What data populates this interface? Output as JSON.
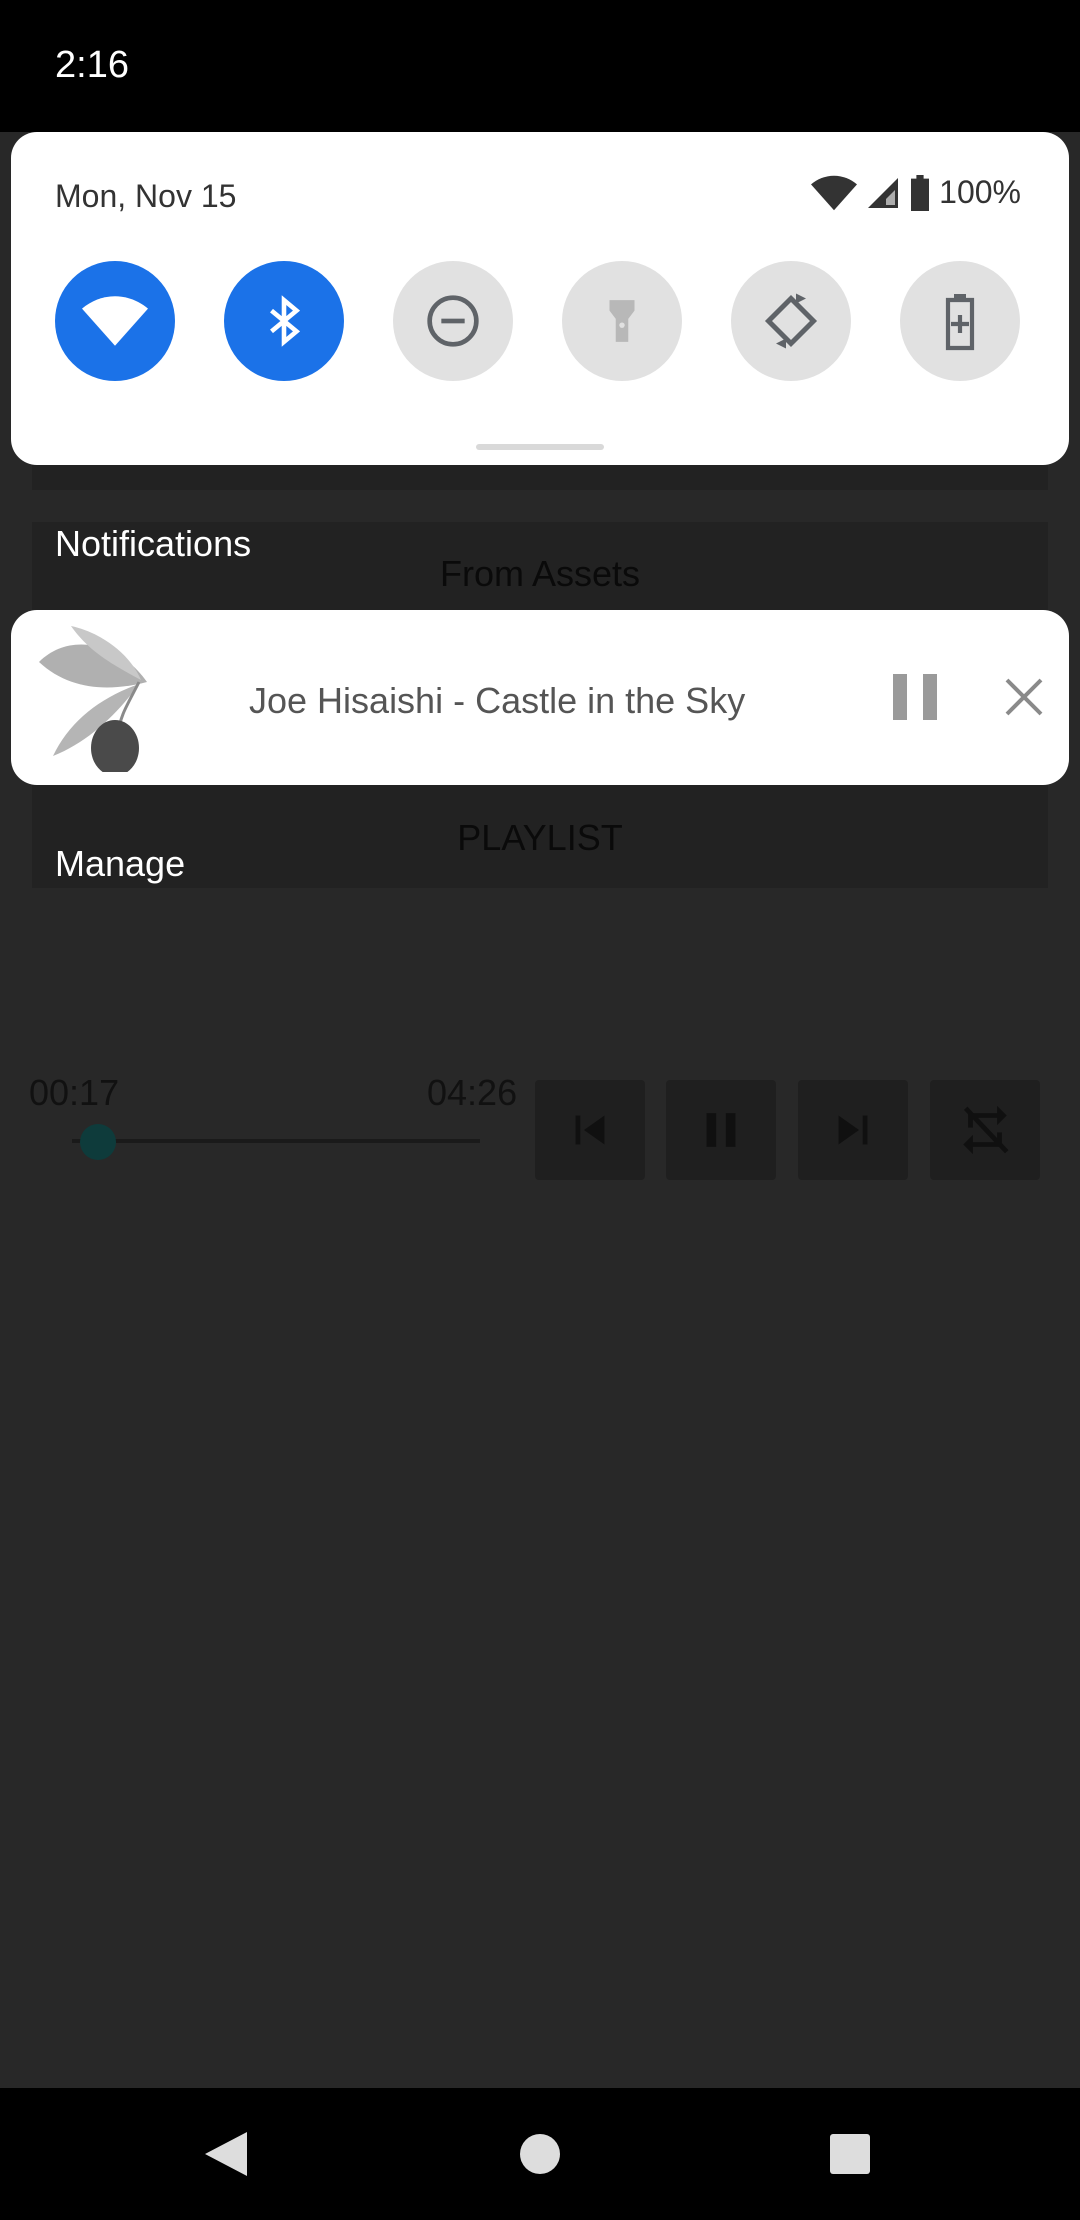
{
  "status_bar": {
    "time": "2:16"
  },
  "quick_settings": {
    "date": "Mon, Nov 15",
    "battery": "100%",
    "tiles": [
      {
        "name": "wifi",
        "icon": "wifi-icon",
        "state": "on"
      },
      {
        "name": "bluetooth",
        "icon": "bluetooth-icon",
        "state": "on"
      },
      {
        "name": "do-not-disturb",
        "icon": "do-not-disturb-icon",
        "state": "off"
      },
      {
        "name": "flashlight",
        "icon": "flashlight-icon",
        "state": "off"
      },
      {
        "name": "auto-rotate",
        "icon": "auto-rotate-icon",
        "state": "off"
      },
      {
        "name": "battery-saver",
        "icon": "battery-saver-icon",
        "state": "off"
      }
    ]
  },
  "notifications": {
    "header": "Notifications",
    "manage": "Manage",
    "media": {
      "title": "Joe Hisaishi - Castle in the Sky",
      "art_icon": "olive-icon",
      "pause_icon": "pause-icon",
      "close_icon": "close-icon"
    }
  },
  "background_app": {
    "from_assets": "From Assets",
    "playlist": "PLAYLIST",
    "elapsed": "00:17",
    "duration": "04:26",
    "progress_fraction": 0.064,
    "controls": [
      "skip-previous-icon",
      "pause-icon",
      "skip-next-icon",
      "repeat-off-icon"
    ]
  },
  "colors": {
    "accent": "#1b72e8",
    "tile_off": "#e1e1e1",
    "scrim": "#282828"
  }
}
